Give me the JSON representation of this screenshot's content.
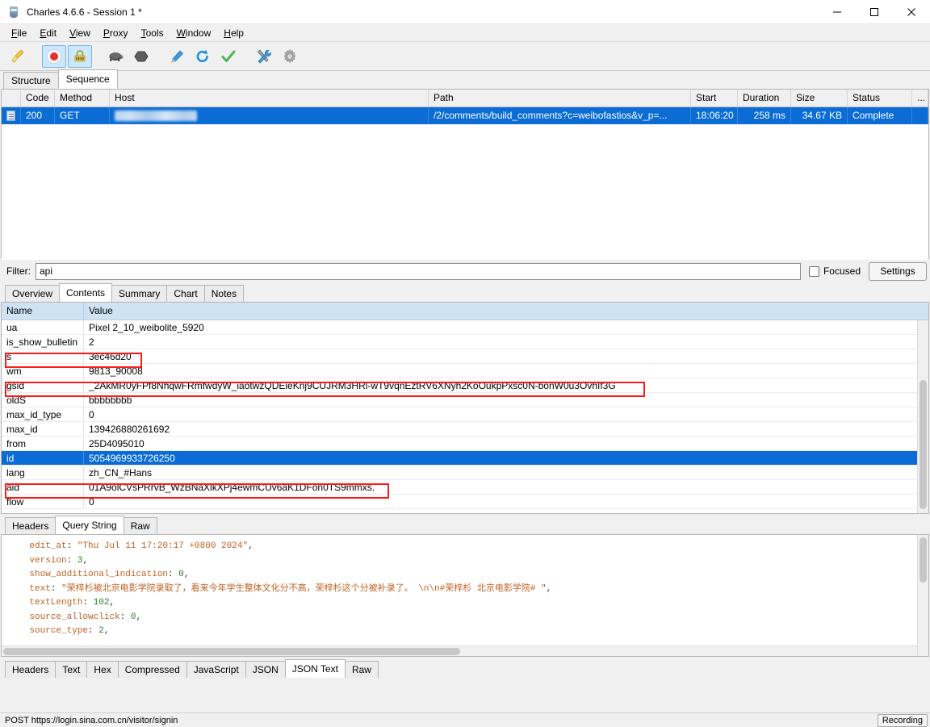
{
  "window": {
    "title": "Charles 4.6.6 - Session 1 *",
    "app_icon": "charles-bottle-icon",
    "minimize_label": "—",
    "maximize_label": "☐",
    "close_label": "✕"
  },
  "menubar": {
    "items": [
      {
        "label": "File",
        "mnemonic": "F",
        "rest": "ile"
      },
      {
        "label": "Edit",
        "mnemonic": "E",
        "rest": "dit"
      },
      {
        "label": "View",
        "mnemonic": "V",
        "rest": "iew"
      },
      {
        "label": "Proxy",
        "mnemonic": "P",
        "rest": "roxy"
      },
      {
        "label": "Tools",
        "mnemonic": "T",
        "rest": "ools"
      },
      {
        "label": "Window",
        "mnemonic": "W",
        "rest": "indow"
      },
      {
        "label": "Help",
        "mnemonic": "H",
        "rest": "elp"
      }
    ]
  },
  "toolbar": {
    "buttons": [
      {
        "name": "clear-session-icon",
        "tip": "Clear Session"
      },
      {
        "name": "record-icon",
        "tip": "Start/Stop Recording",
        "selected": true
      },
      {
        "name": "ssl-proxying-icon",
        "tip": "SSL Proxying",
        "selected": true
      },
      {
        "name": "throttle-turtle-icon",
        "tip": "Start/Stop Throttling"
      },
      {
        "name": "breakpoints-icon",
        "tip": "Enable/Disable Breakpoints"
      },
      {
        "name": "compose-pen-icon",
        "tip": "Compose a new request"
      },
      {
        "name": "repeat-refresh-icon",
        "tip": "Repeat the selected request"
      },
      {
        "name": "validate-check-icon",
        "tip": "Validate"
      },
      {
        "name": "tools-icon",
        "tip": "Tools"
      },
      {
        "name": "settings-gear-icon",
        "tip": "Settings"
      }
    ]
  },
  "view_tabs": {
    "items": [
      "Structure",
      "Sequence"
    ],
    "active": "Sequence"
  },
  "session_table": {
    "columns": [
      "",
      "Code",
      "Method",
      "Host",
      "Path",
      "Start",
      "Duration",
      "Size",
      "Status",
      "..."
    ],
    "rows": [
      {
        "icon": "document-icon",
        "code": "200",
        "method": "GET",
        "host": "",
        "host_redacted": true,
        "path": "/2/comments/build_comments?c=weibofastios&v_p=...",
        "start": "18:06:20",
        "duration": "258 ms",
        "size": "34.67 KB",
        "status": "Complete",
        "selected": true
      }
    ]
  },
  "filter": {
    "label": "Filter:",
    "value": "api",
    "placeholder": "",
    "focused_label": "Focused",
    "focused_checked": false,
    "settings_label": "Settings"
  },
  "detail_tabs": {
    "items": [
      "Overview",
      "Contents",
      "Summary",
      "Chart",
      "Notes"
    ],
    "active": "Contents"
  },
  "params_table": {
    "columns": [
      "Name",
      "Value"
    ],
    "rows": [
      {
        "name": "ua",
        "value": "Pixel 2_10_weibolite_5920",
        "selected": false,
        "highlighted": false
      },
      {
        "name": "is_show_bulletin",
        "value": "2",
        "selected": false,
        "highlighted": false
      },
      {
        "name": "s",
        "value": "3ec46d20",
        "selected": false,
        "highlighted": true
      },
      {
        "name": "wm",
        "value": "9813_90008",
        "selected": false,
        "highlighted": false
      },
      {
        "name": "gsid",
        "value": "_2AkMR0yFPf8NhqwFRmfwdyW_iaotwzQDEieKnj9CUJRM3HRl-wT9vqnEztRV6XNyh2KoOukpPxsc0N-bonW0u3OvhIf3G",
        "selected": false,
        "highlighted": true
      },
      {
        "name": "oldS",
        "value": "bbbbbbbb",
        "selected": false,
        "highlighted": false
      },
      {
        "name": "max_id_type",
        "value": "0",
        "selected": false,
        "highlighted": false
      },
      {
        "name": "max_id",
        "value": "139426880261692",
        "selected": false,
        "highlighted": false
      },
      {
        "name": "from",
        "value": "25D4095010",
        "selected": false,
        "highlighted": false
      },
      {
        "name": "id",
        "value": "5054969933726250",
        "selected": true,
        "highlighted": false
      },
      {
        "name": "lang",
        "value": "zh_CN_#Hans",
        "selected": false,
        "highlighted": false
      },
      {
        "name": "aid",
        "value": "01A9olCVsPRrvB_WzBNaXlkXPj4ewmCUv6aK1DFon0TS9mmxs.",
        "selected": false,
        "highlighted": true
      },
      {
        "name": "flow",
        "value": "0",
        "selected": false,
        "highlighted": false
      }
    ]
  },
  "request_tabs": {
    "items": [
      "Headers",
      "Query String",
      "Raw"
    ],
    "active": "Query String"
  },
  "json_body": {
    "lines": [
      {
        "key": "edit_at",
        "sep": ": ",
        "value": "\"Thu Jul 11 17:20:17 +0800 2024\"",
        "type": "string",
        "trail": ","
      },
      {
        "key": "version",
        "sep": ": ",
        "value": "3",
        "type": "number",
        "trail": ","
      },
      {
        "key": "show_additional_indication",
        "sep": ": ",
        "value": "0",
        "type": "number",
        "trail": ","
      },
      {
        "key": "text",
        "sep": ": ",
        "value": "\"荣梓杉被北京电影学院录取了，看来今年学生整体文化分不高，荣梓杉这个分被补录了。 \\n\\n#荣梓杉 北京电影学院# \"",
        "type": "string",
        "trail": ","
      },
      {
        "key": "textLength",
        "sep": ": ",
        "value": "102",
        "type": "number",
        "trail": ","
      },
      {
        "key": "source_allowclick",
        "sep": ": ",
        "value": "0",
        "type": "number",
        "trail": ","
      },
      {
        "key": "source_type",
        "sep": ": ",
        "value": "2",
        "type": "number",
        "trail": ","
      }
    ]
  },
  "response_tabs": {
    "items": [
      "Headers",
      "Text",
      "Hex",
      "Compressed",
      "JavaScript",
      "JSON",
      "JSON Text",
      "Raw"
    ],
    "active": "JSON Text"
  },
  "statusbar": {
    "text": "POST https://login.sina.com.cn/visitor/signin",
    "recording_label": "Recording"
  },
  "colors": {
    "selection_blue": "#0a6cd4",
    "highlight_red": "#ff1a1a",
    "header_blue": "#cfe3f5",
    "accent_tab": "#ffffff"
  }
}
